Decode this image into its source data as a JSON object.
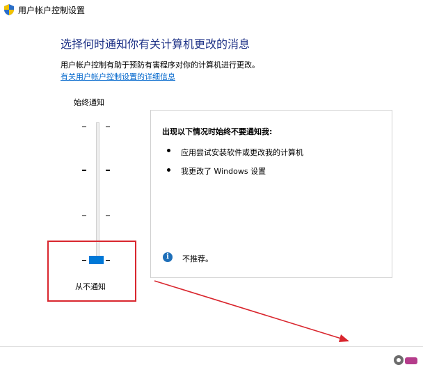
{
  "window": {
    "title": "用户帐户控制设置",
    "icon": "uac-shield-icon"
  },
  "main": {
    "heading": "选择何时通知你有关计算机更改的消息",
    "description": "用户帐户控制有助于预防有害程序对你的计算机进行更改。",
    "more_info_link": "有关用户帐户控制设置的详细信息"
  },
  "slider": {
    "top_label": "始终通知",
    "bottom_label": "从不通知",
    "levels": 4,
    "current_level": 1
  },
  "info_panel": {
    "heading": "出现以下情况时始终不要通知我:",
    "items": [
      "应用尝试安装软件或更改我的计算机",
      "我更改了 Windows 设置"
    ],
    "recommendation": "不推荐。",
    "info_icon": "info-icon"
  },
  "colors": {
    "heading": "#1e3287",
    "link": "#0066cc",
    "thumb": "#0078d7",
    "highlight_box": "#d9262e",
    "arrow": "#d9262e"
  }
}
